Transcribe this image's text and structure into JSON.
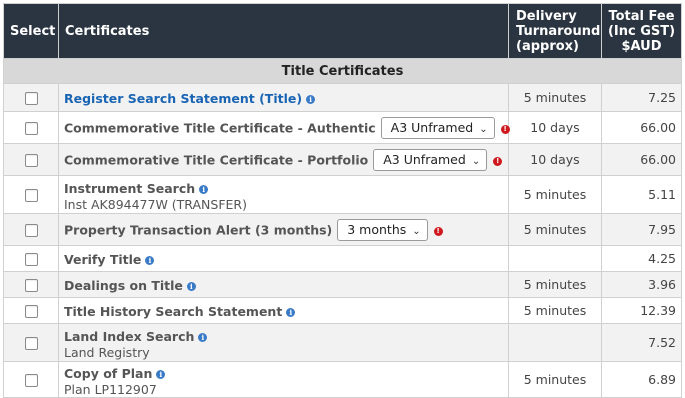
{
  "header": {
    "select": "Select",
    "certificates": "Certificates",
    "delivery": [
      "Delivery",
      "Turnaround",
      "(approx)"
    ],
    "fee": [
      "Total Fee",
      "(Inc GST)",
      "$AUD"
    ]
  },
  "group_title": "Title Certificates",
  "rows": [
    {
      "title": "Register Search Statement (Title)",
      "link": true,
      "info": true,
      "sub": "",
      "dropdown": "",
      "warning": false,
      "delivery": "5 minutes",
      "fee": "7.25"
    },
    {
      "title": "Commemorative Title Certificate - Authentic",
      "link": false,
      "info": false,
      "sub": "",
      "dropdown": "A3 Unframed",
      "warning": true,
      "delivery": "10 days",
      "fee": "66.00"
    },
    {
      "title": "Commemorative Title Certificate - Portfolio",
      "link": false,
      "info": false,
      "sub": "",
      "dropdown": "A3 Unframed",
      "warning": true,
      "delivery": "10 days",
      "fee": "66.00"
    },
    {
      "title": "Instrument Search",
      "link": false,
      "info": true,
      "sub": "Inst AK894477W (TRANSFER)",
      "dropdown": "",
      "warning": false,
      "delivery": "5 minutes",
      "fee": "5.11"
    },
    {
      "title": "Property Transaction Alert (3 months)",
      "link": false,
      "info": false,
      "sub": "",
      "dropdown": "3 months",
      "warning": true,
      "delivery": "5 minutes",
      "fee": "7.95"
    },
    {
      "title": "Verify Title",
      "link": false,
      "info": true,
      "sub": "",
      "dropdown": "",
      "warning": false,
      "delivery": "",
      "fee": "4.25"
    },
    {
      "title": "Dealings on Title",
      "link": false,
      "info": true,
      "sub": "",
      "dropdown": "",
      "warning": false,
      "delivery": "5 minutes",
      "fee": "3.96"
    },
    {
      "title": "Title History Search Statement",
      "link": false,
      "info": true,
      "sub": "",
      "dropdown": "",
      "warning": false,
      "delivery": "5 minutes",
      "fee": "12.39"
    },
    {
      "title": "Land Index Search",
      "link": false,
      "info": true,
      "sub": "Land Registry",
      "dropdown": "",
      "warning": false,
      "delivery": "",
      "fee": "7.52"
    },
    {
      "title": "Copy of Plan",
      "link": false,
      "info": true,
      "sub": "Plan LP112907",
      "dropdown": "",
      "warning": false,
      "delivery": "5 minutes",
      "fee": "6.89"
    }
  ],
  "colors": {
    "header_bg": "#2b3542",
    "group_bg": "#d8d8d8",
    "link": "#1a64b4",
    "info_icon": "#3a7bc8",
    "warning_icon": "#d0181f"
  }
}
